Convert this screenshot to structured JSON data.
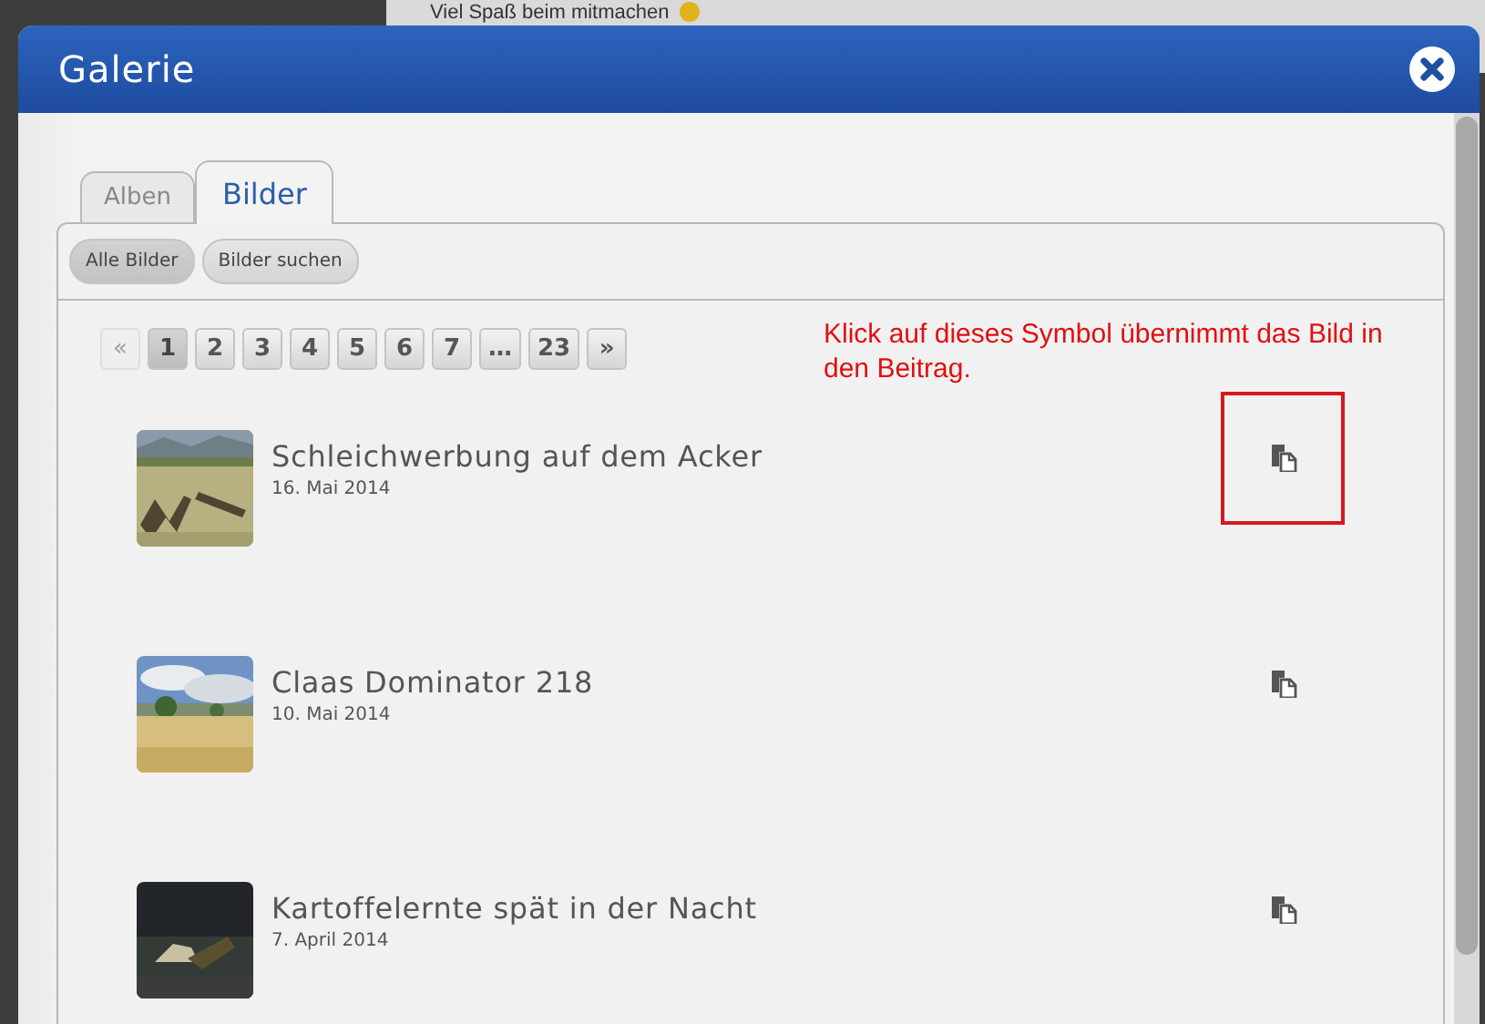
{
  "background": {
    "text": "Viel Spaß beim mitmachen"
  },
  "window": {
    "title": "Galerie"
  },
  "tabs": [
    {
      "label": "Alben",
      "selected": false
    },
    {
      "label": "Bilder",
      "selected": true
    }
  ],
  "filters": [
    {
      "label": "Alle Bilder",
      "selected": true
    },
    {
      "label": "Bilder suchen",
      "selected": false
    }
  ],
  "pagination": [
    {
      "label": "«",
      "selected": false,
      "disabled": true
    },
    {
      "label": "1",
      "selected": true,
      "disabled": false
    },
    {
      "label": "2",
      "selected": false,
      "disabled": false
    },
    {
      "label": "3",
      "selected": false,
      "disabled": false
    },
    {
      "label": "4",
      "selected": false,
      "disabled": false
    },
    {
      "label": "5",
      "selected": false,
      "disabled": false
    },
    {
      "label": "6",
      "selected": false,
      "disabled": false
    },
    {
      "label": "7",
      "selected": false,
      "disabled": false
    },
    {
      "label": "…",
      "selected": false,
      "disabled": false
    },
    {
      "label": "23",
      "selected": false,
      "disabled": false
    },
    {
      "label": "»",
      "selected": false,
      "disabled": false
    }
  ],
  "annotation": {
    "text": "Klick auf dieses Symbol übernimmt das Bild in den Beitrag."
  },
  "images": [
    {
      "title": "Schleichwerbung auf dem Acker",
      "date": "16. Mai 2014",
      "kind": "field-letters",
      "highlighted": true
    },
    {
      "title": "Claas Dominator 218",
      "date": "10. Mai 2014",
      "kind": "wheat",
      "highlighted": false
    },
    {
      "title": "Kartoffelernte spät in der Nacht",
      "date": "7. April 2014",
      "kind": "night",
      "highlighted": false
    }
  ]
}
